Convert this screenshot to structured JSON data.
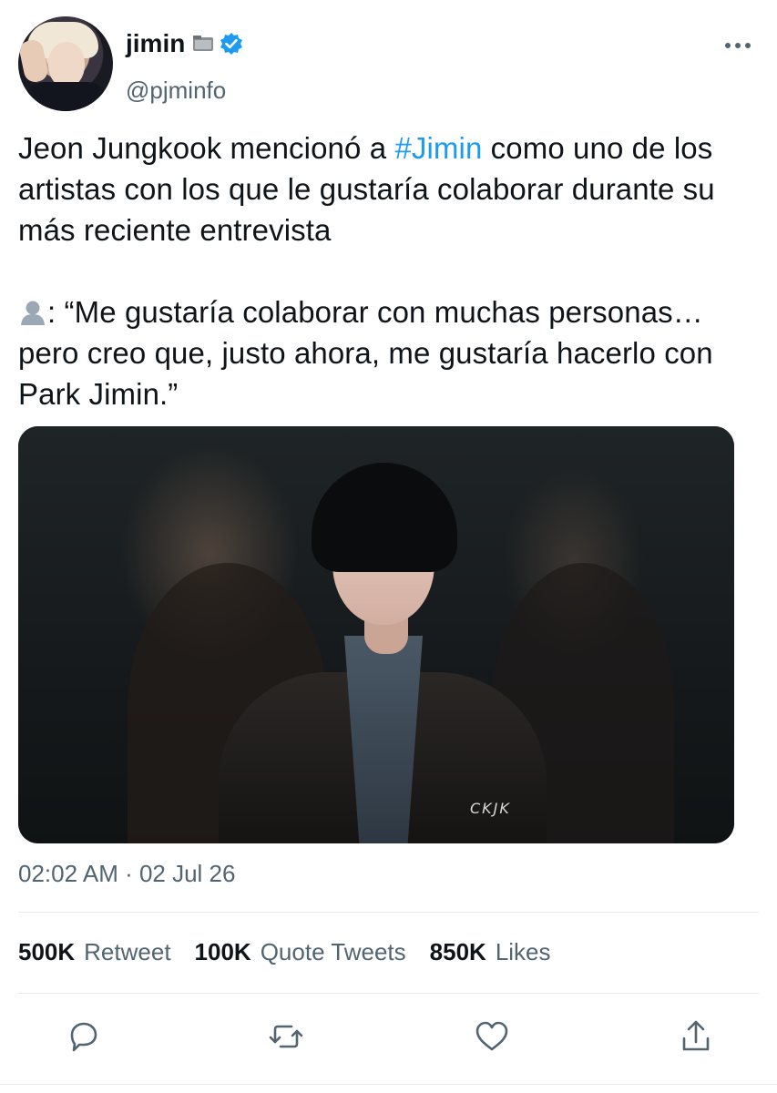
{
  "author": {
    "name": "jimin",
    "handle": "@pjminfo",
    "verified": true
  },
  "tweet": {
    "text_before_hashtag": "Jeon Jungkook mencionó a ",
    "hashtag": "#Jimin",
    "text_after_hashtag": " como uno de los artistas con los que le gustaría colaborar durante su más reciente entrevista",
    "quote_prefix": ": ",
    "quote": "“Me gustaría colaborar con muchas personas… pero creo que, justo ahora, me gustaría hacerlo con Park Jimin.”",
    "media_logo_text": "CKJK"
  },
  "timestamp": "02:02 AM · 02 Jul 26",
  "stats": {
    "retweets_count": "500K",
    "retweets_label": "Retweet",
    "quotes_count": "100K",
    "quotes_label": "Quote Tweets",
    "likes_count": "850K",
    "likes_label": "Likes"
  },
  "actions": [
    "reply-icon",
    "retweet-icon",
    "like-icon",
    "share-icon"
  ],
  "colors": {
    "text": "#0f1419",
    "secondary": "#536471",
    "accent": "#1d9bf0",
    "divider": "#e6e9ec"
  }
}
